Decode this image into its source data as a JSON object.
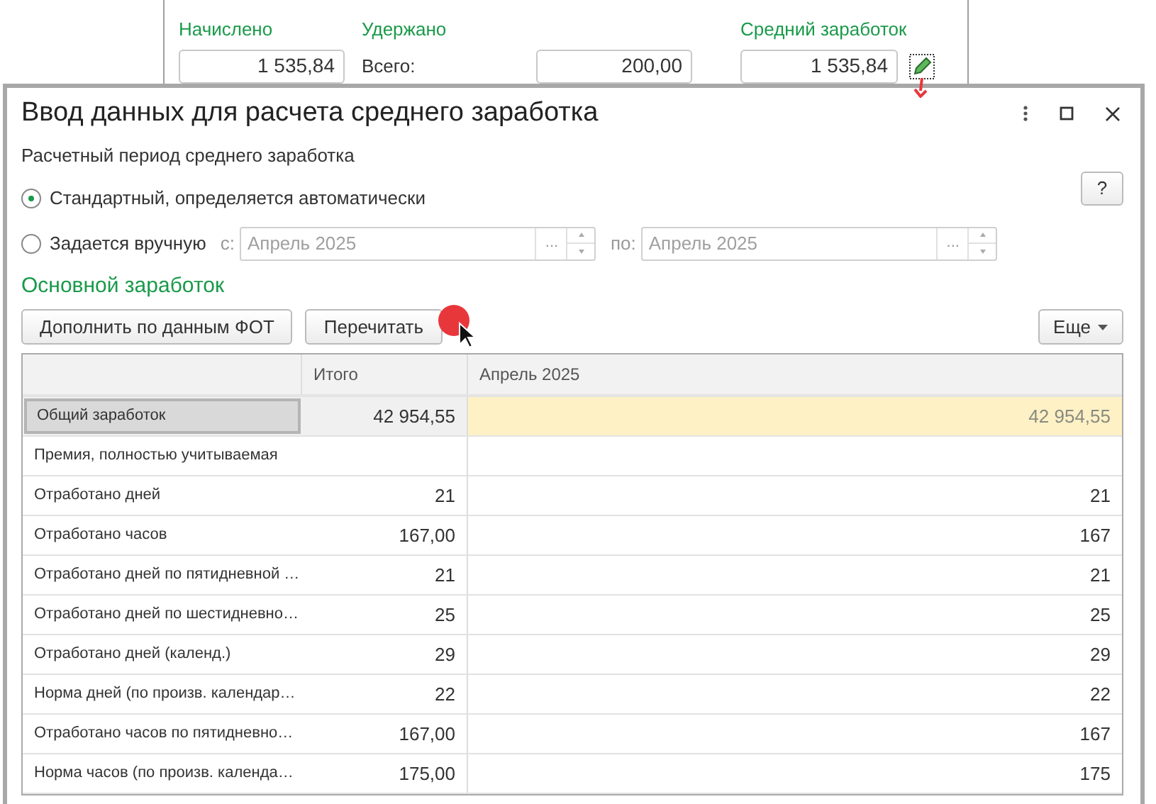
{
  "summary": {
    "accrued": {
      "label": "Начислено",
      "value": "1 535,84"
    },
    "withheld": {
      "label": "Удержано",
      "total_label": "Всего:",
      "value": "200,00"
    },
    "average": {
      "label": "Средний заработок",
      "value": "1 535,84"
    }
  },
  "window": {
    "title": "Ввод данных для расчета среднего заработка",
    "help": "?"
  },
  "period": {
    "label": "Расчетный период среднего заработка",
    "options": [
      {
        "label": "Стандартный, определяется автоматически",
        "selected": true
      },
      {
        "label": "Задается вручную",
        "selected": false
      }
    ],
    "from_label": "с:",
    "from": "Апрель 2025",
    "to_label": "по:",
    "to": "Апрель 2025",
    "choose": "...",
    "disabled": true
  },
  "section": {
    "title": "Основной заработок"
  },
  "buttons": [
    "Дополнить по данным ФОТ",
    "Перечитать"
  ],
  "more": "Еще",
  "table": {
    "columns": [
      "Итого",
      "Апрель 2025"
    ],
    "rows": [
      {
        "label": "Общий заработок",
        "total": "42 954,55",
        "month": "42 954,55",
        "selected": true
      },
      {
        "label": "Премия, полностью учитываемая",
        "selected": false
      },
      {
        "label": "Отработано дней",
        "total": "21",
        "month": "21",
        "selected": false
      },
      {
        "label": "Отработано часов",
        "total": "167,00",
        "month": "167",
        "selected": false
      },
      {
        "label": "Отработано дней по пятидневной …",
        "total": "21",
        "month": "21",
        "selected": false
      },
      {
        "label": "Отработано дней по шестидневно…",
        "total": "25",
        "month": "25",
        "selected": false
      },
      {
        "label": "Отработано дней (календ.)",
        "total": "29",
        "month": "29",
        "selected": false
      },
      {
        "label": "Норма дней (по произв. календар…",
        "total": "22",
        "month": "22",
        "selected": false
      },
      {
        "label": "Отработано часов по пятидневно…",
        "total": "167,00",
        "month": "167",
        "selected": false
      },
      {
        "label": "Норма часов (по произв. календа…",
        "total": "175,00",
        "month": "175",
        "selected": false
      }
    ]
  }
}
